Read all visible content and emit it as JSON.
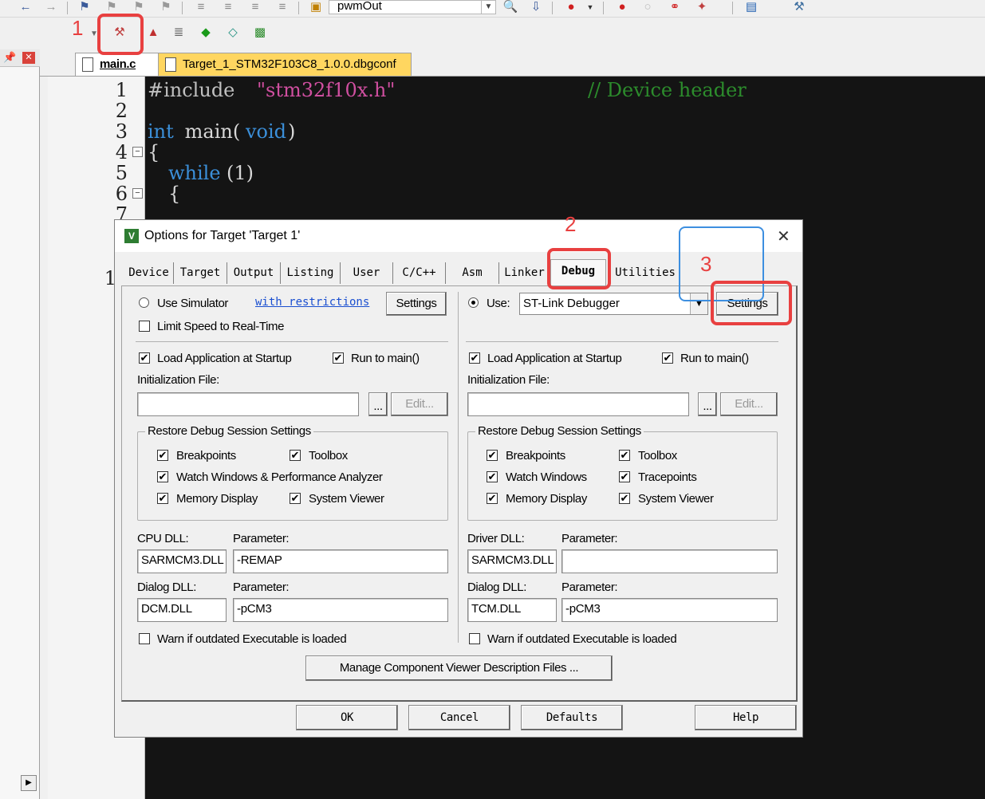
{
  "toolbar": {
    "target_combo": "pwmOut"
  },
  "editor": {
    "tabs": [
      {
        "label": "main.c"
      },
      {
        "label": "Target_1_STM32F103C8_1.0.0.dbgconf"
      }
    ],
    "line_numbers": [
      "1",
      "2",
      "3",
      "4",
      "5",
      "6",
      "7"
    ],
    "hidden_line_number": "1",
    "code": {
      "line1_directive": "#include",
      "line1_header": "\"stm32f10x.h\"",
      "line1_comment": "// Device header",
      "line3_type": "int",
      "line3_name": " main(",
      "line3_void": "void",
      "line3_end": ")",
      "line4": "{",
      "line5_kw": "while",
      "line5_rest": "(1)",
      "line6": "{"
    }
  },
  "annotations": {
    "n1": "1",
    "n2": "2",
    "n3": "3"
  },
  "dialog": {
    "title": "Options for Target 'Target 1'",
    "tabs": [
      "Device",
      "Target",
      "Output",
      "Listing",
      "User",
      "C/C++",
      "Asm",
      "Linker",
      "Debug",
      "Utilities"
    ],
    "active_tab": "Debug",
    "left": {
      "use_simulator": "Use Simulator",
      "with_restrictions": "with restrictions",
      "settings": "Settings",
      "limit_speed": "Limit Speed to Real-Time",
      "load_app": "Load Application at Startup",
      "run_to_main": "Run to main()",
      "init_file": "Initialization File:",
      "init_file_value": "",
      "browse": "...",
      "edit": "Edit...",
      "restore_title": "Restore Debug Session Settings",
      "breakpoints": "Breakpoints",
      "toolbox": "Toolbox",
      "watch": "Watch Windows & Performance Analyzer",
      "memory": "Memory Display",
      "system_viewer": "System Viewer",
      "cpu_dll_label": "CPU DLL:",
      "cpu_param_label": "Parameter:",
      "cpu_dll": "SARMCM3.DLL",
      "cpu_param": "-REMAP",
      "dialog_dll_label": "Dialog DLL:",
      "dialog_param_label": "Parameter:",
      "dialog_dll": "DCM.DLL",
      "dialog_param": "-pCM3",
      "warn": "Warn if outdated Executable is loaded"
    },
    "right": {
      "use": "Use:",
      "debugger": "ST-Link Debugger",
      "settings": "Settings",
      "load_app": "Load Application at Startup",
      "run_to_main": "Run to main()",
      "init_file": "Initialization File:",
      "init_file_value": "",
      "browse": "...",
      "edit": "Edit...",
      "restore_title": "Restore Debug Session Settings",
      "breakpoints": "Breakpoints",
      "toolbox": "Toolbox",
      "watch": "Watch Windows",
      "tracepoints": "Tracepoints",
      "memory": "Memory Display",
      "system_viewer": "System Viewer",
      "driver_dll_label": "Driver DLL:",
      "driver_param_label": "Parameter:",
      "driver_dll": "SARMCM3.DLL",
      "driver_param": "",
      "dialog_dll_label": "Dialog DLL:",
      "dialog_param_label": "Parameter:",
      "dialog_dll": "TCM.DLL",
      "dialog_param": "-pCM3",
      "warn": "Warn if outdated Executable is loaded"
    },
    "manage": "Manage Component Viewer Description Files ...",
    "buttons": {
      "ok": "OK",
      "cancel": "Cancel",
      "defaults": "Defaults",
      "help": "Help"
    }
  },
  "colors": {
    "editor_bg": "#141414",
    "annotation_red": "#e84040",
    "annotation_blue": "#3d8fe0",
    "tab_dbgconf": "#ffd660"
  }
}
